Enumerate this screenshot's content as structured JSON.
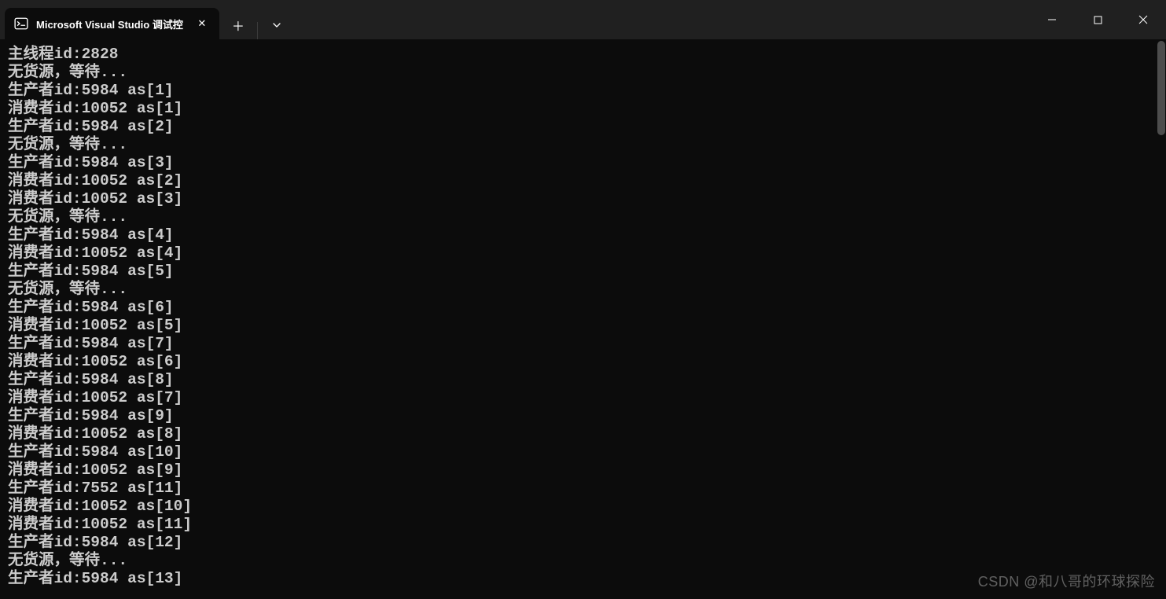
{
  "tab": {
    "title": "Microsoft Visual Studio 调试控",
    "close_glyph": "✕"
  },
  "titlebar": {
    "new_tab_glyph": "＋",
    "dropdown_glyph": "⌄"
  },
  "window_controls": {
    "minimize": "—",
    "maximize": "☐",
    "close": "✕"
  },
  "console": {
    "lines": [
      "主线程id:2828",
      "无货源，等待...",
      "生产者id:5984 as[1]",
      "消费者id:10052 as[1]",
      "生产者id:5984 as[2]",
      "无货源，等待...",
      "生产者id:5984 as[3]",
      "消费者id:10052 as[2]",
      "消费者id:10052 as[3]",
      "无货源，等待...",
      "生产者id:5984 as[4]",
      "消费者id:10052 as[4]",
      "生产者id:5984 as[5]",
      "无货源，等待...",
      "生产者id:5984 as[6]",
      "消费者id:10052 as[5]",
      "生产者id:5984 as[7]",
      "消费者id:10052 as[6]",
      "生产者id:5984 as[8]",
      "消费者id:10052 as[7]",
      "生产者id:5984 as[9]",
      "消费者id:10052 as[8]",
      "生产者id:5984 as[10]",
      "消费者id:10052 as[9]",
      "生产者id:7552 as[11]",
      "消费者id:10052 as[10]",
      "消费者id:10052 as[11]",
      "生产者id:5984 as[12]",
      "无货源，等待...",
      "生产者id:5984 as[13]"
    ]
  },
  "watermark": "CSDN @和八哥的环球探险"
}
